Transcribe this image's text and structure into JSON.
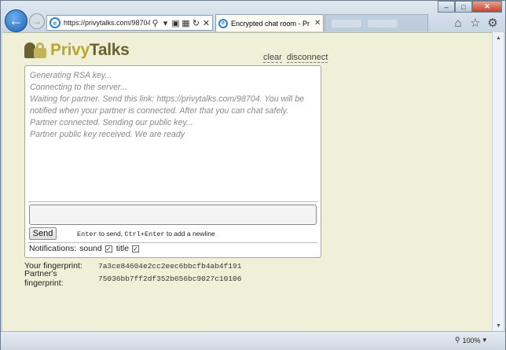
{
  "browser": {
    "address_url": "https://privytalks.com/98704",
    "active_tab_title": "Encrypted chat room - Priv...",
    "zoom_level": "100%"
  },
  "logo": {
    "part1": "Privy",
    "part2": "Talks"
  },
  "links": {
    "clear": "clear",
    "disconnect": "disconnect"
  },
  "chat_log": [
    "Generating RSA key...",
    "Connecting to the server...",
    "Waiting for partner. Send this link: https://privytalks.com/98704. You will be notified when your partner is connected. After that you can chat safely.",
    "Partner connected. Sending our public key...",
    "Partner public key received. We are ready"
  ],
  "composer": {
    "send_label": "Send",
    "hint_key1": "Enter",
    "hint_text1": " to send, ",
    "hint_key2": "Ctrl+Enter",
    "hint_text2": " to add a newline"
  },
  "notifications": {
    "label": "Notifications:",
    "sound_label": "sound",
    "sound_checked": true,
    "title_label": "title",
    "title_checked": true
  },
  "fingerprints": {
    "yours_label": "Your fingerprint:",
    "yours_value": "7a3ce84604e2cc2eec6bbcfb4ab4f191",
    "partner_label": "Partner's fingerprint:",
    "partner_value": "75036bb7ff2df352b656bc9027c10106"
  },
  "icons": {
    "back": "back-arrow-icon",
    "forward": "forward-arrow-icon",
    "home": "home-icon",
    "favorites": "star-icon",
    "settings": "gear-icon"
  }
}
